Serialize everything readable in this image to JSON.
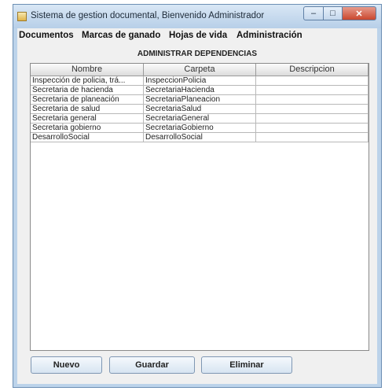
{
  "window": {
    "title": "Sistema de gestion documental, Bienvenido Administrador",
    "minimize_symbol": "–",
    "maximize_symbol": "□",
    "close_symbol": "✕"
  },
  "menu": {
    "items": [
      "Documentos",
      "Marcas de ganado",
      "Hojas de vida",
      "Administración"
    ]
  },
  "heading": "ADMINISTRAR DEPENDENCIAS",
  "table": {
    "columns": [
      "Nombre",
      "Carpeta",
      "Descripcion"
    ],
    "rows": [
      [
        "Inspección de policia, trá...",
        "InspeccionPolicia",
        ""
      ],
      [
        "Secretaria de hacienda",
        "SecretariaHacienda",
        ""
      ],
      [
        "Secretaria de planeación",
        "SecretariaPlaneacion",
        ""
      ],
      [
        "Secretaria de salud",
        "SecretariaSalud",
        ""
      ],
      [
        "Secretaria general",
        "SecretariaGeneral",
        ""
      ],
      [
        "Secretaria gobierno",
        "SecretariaGobierno",
        ""
      ],
      [
        "DesarrolloSocial",
        "DesarrolloSocial",
        ""
      ]
    ]
  },
  "buttons": {
    "new_label": "Nuevo",
    "save_label": "Guardar",
    "delete_label": "Eliminar"
  }
}
